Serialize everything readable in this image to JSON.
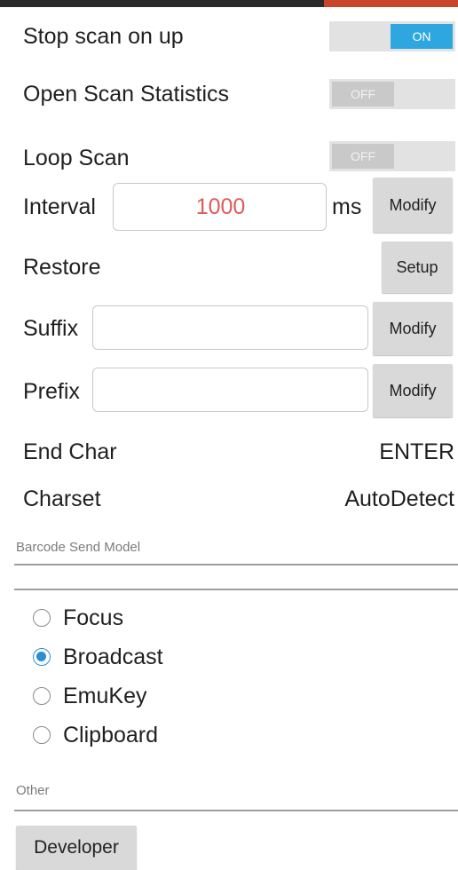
{
  "settings": {
    "stop_scan_on_up": {
      "label": "Stop scan on up",
      "toggle": "ON"
    },
    "open_scan_statistics": {
      "label": "Open Scan Statistics",
      "toggle": "OFF"
    },
    "loop_scan": {
      "label": "Loop Scan",
      "toggle": "OFF"
    },
    "interval": {
      "label": "Interval",
      "value": "1000",
      "unit": "ms",
      "button": "Modify"
    },
    "restore": {
      "label": "Restore",
      "button": "Setup"
    },
    "suffix": {
      "label": "Suffix",
      "value": "",
      "button": "Modify"
    },
    "prefix": {
      "label": "Prefix",
      "value": "",
      "button": "Modify"
    },
    "end_char": {
      "label": "End Char",
      "value": "ENTER"
    },
    "charset": {
      "label": "Charset",
      "value": "AutoDetect"
    }
  },
  "barcode_send_model": {
    "header": "Barcode Send Model",
    "options": [
      {
        "label": "Focus",
        "selected": false
      },
      {
        "label": "Broadcast",
        "selected": true
      },
      {
        "label": "EmuKey",
        "selected": false
      },
      {
        "label": "Clipboard",
        "selected": false
      }
    ]
  },
  "other": {
    "header": "Other",
    "developer_button": "Developer"
  },
  "colors": {
    "accent_blue": "#2ea7e0",
    "interval_value_red": "#e05a5a",
    "status_bar_dark": "#2a2a2a",
    "status_bar_orange": "#c8452b"
  }
}
